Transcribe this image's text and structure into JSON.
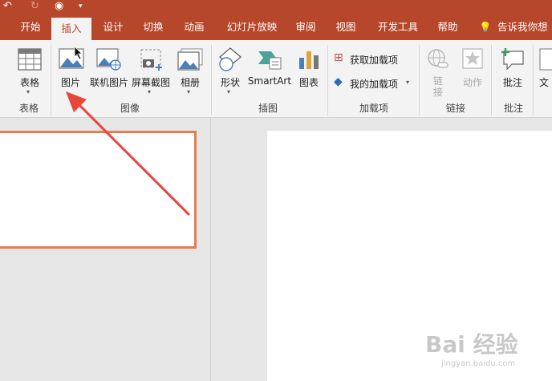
{
  "quick_access": {
    "undo": "↶",
    "redo": "↷"
  },
  "tabs": [
    "开始",
    "插入",
    "设计",
    "切换",
    "动画",
    "幻灯片放映",
    "审阅",
    "视图",
    "开发工具",
    "帮助"
  ],
  "tell_me": "告诉我你想",
  "buttons": {
    "table": "表格",
    "picture": "图片",
    "online_picture": "联机图片",
    "screenshot": "屏幕截图",
    "album": "相册",
    "shapes": "形状",
    "smartart": "SmartArt",
    "chart": "图表",
    "get_addins": "获取加载项",
    "my_addins": "我的加载项",
    "link": "链\n接",
    "action": "动作",
    "comment": "批注",
    "text": "文"
  },
  "groups": {
    "table": "表格",
    "images": "图像",
    "illustrations": "插图",
    "addins": "加载项",
    "links": "链接",
    "comments": "批注"
  },
  "watermark": {
    "main": "Bai 经验",
    "sub": "jingyan.baidu.com"
  },
  "colors": {
    "accent": "#b7472a",
    "arrow": "#e8453c",
    "thumb_border": "#e87b52"
  }
}
